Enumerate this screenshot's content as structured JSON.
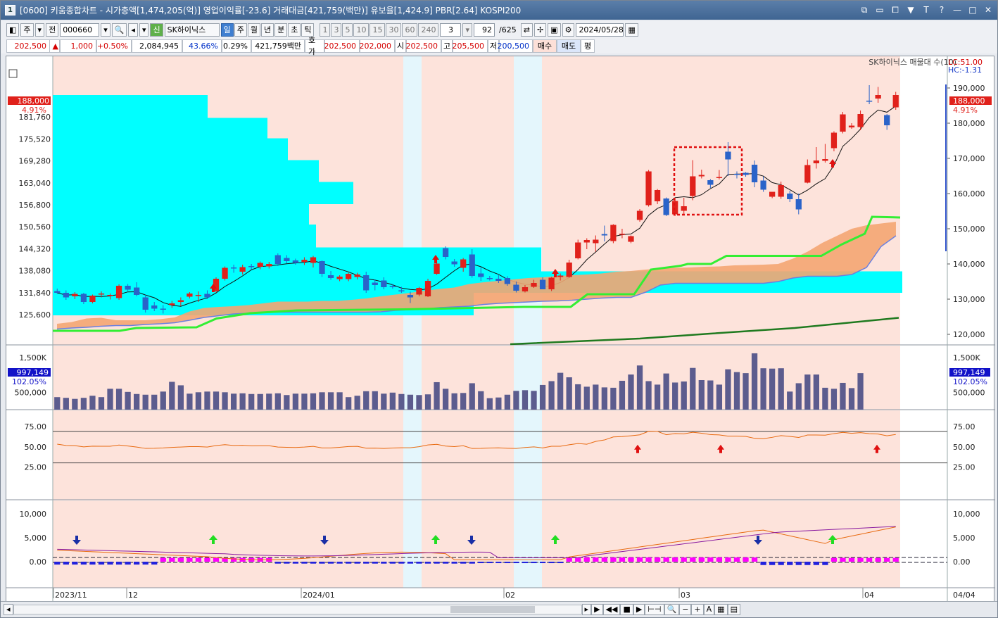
{
  "window": {
    "title": "[0600] 키움종합차트 - 시가총액[1,474,205(억)] 영업이익률[-23.6] 거래대금[421,759(백만)] 유보율[1,424.9] PBR[2.64] KOSPI200",
    "icon_label": "1",
    "controls": [
      "link-icon",
      "minimize-box-icon",
      "restore-box-icon",
      "pin-icon",
      "font-icon",
      "help-icon",
      "minimize-icon",
      "maximize-icon",
      "close-icon"
    ]
  },
  "toolbar": {
    "period_type": "주",
    "all_label": "전",
    "code": "000660",
    "badge": "신",
    "stock_name": "SK하이닉스",
    "periods": [
      "일",
      "주",
      "월",
      "년",
      "분",
      "초",
      "틱"
    ],
    "active_period": "일",
    "intervals": [
      "1",
      "3",
      "5",
      "10",
      "15",
      "30",
      "60",
      "240"
    ],
    "interval_value": "3",
    "count": "92",
    "total": "/625",
    "date": "2024/05/28"
  },
  "quote": {
    "price": "202,500",
    "change_sign": "▲",
    "change": "1,000",
    "change_pct": "+0.50%",
    "volume": "2,084,945",
    "vol_ratio": "43.66%",
    "turnover_pct": "0.29%",
    "amount": "421,759백만",
    "hoga_label": "호가",
    "hoga_ask": "202,500",
    "hoga_bid": "202,000",
    "open_label": "시",
    "open": "202,500",
    "high_label": "고",
    "high": "205,500",
    "low_label": "저",
    "low": "200,500",
    "buy_label": "매수",
    "sell_label": "매도",
    "flat_label": "평"
  },
  "colors": {
    "up": "#e0211b",
    "down": "#2a63c9",
    "background_shade": "#fde3db",
    "highlight_band": "#e4f6fc",
    "volume_profile": "#00ffff",
    "cloud": "#f4a572",
    "leading_span": "#33ee33",
    "long_ma": "#1f7a1f",
    "volume_bar": "#5c5c8e",
    "oscillator": "#ff00ff"
  },
  "legend": {
    "series_name": "SK하이닉스 매물대 수(10)",
    "lc": "LC:51.00",
    "hc": "HC:-1.31"
  },
  "price_panel": {
    "current_price_label": "188,000",
    "current_pct_label": "4.91%",
    "left_ticks": [
      "181,760",
      "175,520",
      "169,280",
      "163,040",
      "156,800",
      "150,560",
      "144,320",
      "138,080",
      "131,840",
      "125,600"
    ],
    "right_ticks": [
      "190,000",
      "180,000",
      "170,000",
      "160,000",
      "150,000",
      "140,000",
      "130,000",
      "120,000"
    ]
  },
  "volume_panel": {
    "ticks": [
      "1,500K",
      "500,000"
    ],
    "current_label": "997,149",
    "current_pct": "102.05%"
  },
  "rsi_panel": {
    "ticks": [
      "75.00",
      "50.00",
      "25.00"
    ]
  },
  "macd_panel": {
    "ticks": [
      "10,000",
      "5,000",
      "0.00"
    ]
  },
  "x_axis": {
    "labels": [
      "2023/11",
      "12",
      "2024/01",
      "02",
      "03",
      "04"
    ],
    "right_label": "04/04"
  },
  "chart_data": {
    "type": "candlestick",
    "y_range": [
      117000,
      193000
    ],
    "candles": [
      {
        "o": 132300,
        "h": 133000,
        "l": 131500,
        "c": 131800
      },
      {
        "o": 131800,
        "h": 132500,
        "l": 129800,
        "c": 130500
      },
      {
        "o": 130800,
        "h": 132000,
        "l": 130000,
        "c": 131500
      },
      {
        "o": 131500,
        "h": 131800,
        "l": 128600,
        "c": 129200
      },
      {
        "o": 129200,
        "h": 131300,
        "l": 128800,
        "c": 131000
      },
      {
        "o": 131300,
        "h": 132200,
        "l": 130500,
        "c": 131600
      },
      {
        "o": 130900,
        "h": 131600,
        "l": 129900,
        "c": 131200
      },
      {
        "o": 130300,
        "h": 134200,
        "l": 129800,
        "c": 133800
      },
      {
        "o": 133800,
        "h": 134300,
        "l": 132300,
        "c": 132700
      },
      {
        "o": 133300,
        "h": 134800,
        "l": 130800,
        "c": 131200
      },
      {
        "o": 130500,
        "h": 131200,
        "l": 126200,
        "c": 127000
      },
      {
        "o": 128200,
        "h": 129200,
        "l": 126600,
        "c": 127300
      },
      {
        "o": 127300,
        "h": 128300,
        "l": 125900,
        "c": 127000
      },
      {
        "o": 128300,
        "h": 129500,
        "l": 127500,
        "c": 128800
      },
      {
        "o": 129200,
        "h": 130500,
        "l": 128000,
        "c": 129700
      },
      {
        "o": 130700,
        "h": 132000,
        "l": 130200,
        "c": 131600
      },
      {
        "o": 131000,
        "h": 132200,
        "l": 129200,
        "c": 131200
      },
      {
        "o": 131500,
        "h": 132500,
        "l": 130000,
        "c": 130500
      },
      {
        "o": 132300,
        "h": 136200,
        "l": 131800,
        "c": 135800
      },
      {
        "o": 135800,
        "h": 139300,
        "l": 135300,
        "c": 138900
      },
      {
        "o": 139000,
        "h": 139800,
        "l": 137500,
        "c": 138700
      },
      {
        "o": 137800,
        "h": 139800,
        "l": 137000,
        "c": 139100
      },
      {
        "o": 139400,
        "h": 140000,
        "l": 138400,
        "c": 139200
      },
      {
        "o": 139200,
        "h": 140700,
        "l": 138500,
        "c": 140300
      },
      {
        "o": 139300,
        "h": 140600,
        "l": 138700,
        "c": 140000
      },
      {
        "o": 142500,
        "h": 143000,
        "l": 139400,
        "c": 140000
      },
      {
        "o": 141700,
        "h": 142500,
        "l": 140200,
        "c": 140800
      },
      {
        "o": 141000,
        "h": 141500,
        "l": 139800,
        "c": 140300
      },
      {
        "o": 140600,
        "h": 141900,
        "l": 139700,
        "c": 141200
      },
      {
        "o": 140300,
        "h": 142300,
        "l": 139000,
        "c": 141900
      },
      {
        "o": 140800,
        "h": 141000,
        "l": 136300,
        "c": 137200
      },
      {
        "o": 136800,
        "h": 138000,
        "l": 135500,
        "c": 136000
      },
      {
        "o": 135700,
        "h": 136800,
        "l": 135100,
        "c": 136400
      },
      {
        "o": 135700,
        "h": 137500,
        "l": 135100,
        "c": 137200
      },
      {
        "o": 136300,
        "h": 137500,
        "l": 135600,
        "c": 137000
      },
      {
        "o": 136800,
        "h": 137800,
        "l": 131800,
        "c": 132500
      },
      {
        "o": 134700,
        "h": 135600,
        "l": 132500,
        "c": 134000
      },
      {
        "o": 135300,
        "h": 136200,
        "l": 132800,
        "c": 133400
      },
      {
        "o": 133700,
        "h": 134300,
        "l": 133000,
        "c": 133500
      },
      {
        "o": 132500,
        "h": 133500,
        "l": 131800,
        "c": 132300
      },
      {
        "o": 131200,
        "h": 132100,
        "l": 128900,
        "c": 130500
      },
      {
        "o": 131300,
        "h": 133500,
        "l": 130800,
        "c": 133200
      },
      {
        "o": 130800,
        "h": 135800,
        "l": 130600,
        "c": 135200
      },
      {
        "o": 137200,
        "h": 140700,
        "l": 136900,
        "c": 140100
      },
      {
        "o": 144500,
        "h": 145000,
        "l": 141300,
        "c": 142000
      },
      {
        "o": 140700,
        "h": 141400,
        "l": 139200,
        "c": 139900
      },
      {
        "o": 138900,
        "h": 141700,
        "l": 137800,
        "c": 141300
      },
      {
        "o": 142700,
        "h": 144200,
        "l": 136100,
        "c": 136600
      },
      {
        "o": 137300,
        "h": 139000,
        "l": 135200,
        "c": 136300
      },
      {
        "o": 136000,
        "h": 136600,
        "l": 135300,
        "c": 135800
      },
      {
        "o": 135800,
        "h": 136800,
        "l": 134600,
        "c": 135200
      },
      {
        "o": 136000,
        "h": 136500,
        "l": 133800,
        "c": 134300
      },
      {
        "o": 134100,
        "h": 135000,
        "l": 131900,
        "c": 132400
      },
      {
        "o": 132200,
        "h": 134000,
        "l": 131900,
        "c": 133400
      },
      {
        "o": 133500,
        "h": 135500,
        "l": 133200,
        "c": 134600
      },
      {
        "o": 135500,
        "h": 136200,
        "l": 132800,
        "c": 132800
      },
      {
        "o": 132800,
        "h": 136300,
        "l": 132300,
        "c": 136100
      },
      {
        "o": 136300,
        "h": 137300,
        "l": 135300,
        "c": 136700
      },
      {
        "o": 136300,
        "h": 141200,
        "l": 136100,
        "c": 140400
      },
      {
        "o": 141600,
        "h": 146900,
        "l": 141300,
        "c": 146100
      },
      {
        "o": 146100,
        "h": 147300,
        "l": 144200,
        "c": 146800
      },
      {
        "o": 145900,
        "h": 148100,
        "l": 143500,
        "c": 146900
      },
      {
        "o": 148500,
        "h": 150900,
        "l": 146400,
        "c": 148100
      },
      {
        "o": 146500,
        "h": 151300,
        "l": 145900,
        "c": 151100
      },
      {
        "o": 148300,
        "h": 150000,
        "l": 147300,
        "c": 148600
      },
      {
        "o": 146300,
        "h": 148100,
        "l": 145900,
        "c": 147900
      },
      {
        "o": 152500,
        "h": 155600,
        "l": 152000,
        "c": 155100
      },
      {
        "o": 156700,
        "h": 166700,
        "l": 156300,
        "c": 166300
      },
      {
        "o": 157800,
        "h": 161300,
        "l": 157000,
        "c": 161000
      },
      {
        "o": 158600,
        "h": 158900,
        "l": 153600,
        "c": 153900
      },
      {
        "o": 154100,
        "h": 158800,
        "l": 153600,
        "c": 157900
      },
      {
        "o": 155100,
        "h": 158800,
        "l": 154200,
        "c": 156400
      },
      {
        "o": 159300,
        "h": 169500,
        "l": 158100,
        "c": 164900
      },
      {
        "o": 164900,
        "h": 166800,
        "l": 164300,
        "c": 165300
      },
      {
        "o": 163800,
        "h": 164100,
        "l": 161600,
        "c": 162500
      },
      {
        "o": 164400,
        "h": 166700,
        "l": 164000,
        "c": 164700
      },
      {
        "o": 171900,
        "h": 174600,
        "l": 165000,
        "c": 169700
      },
      {
        "o": 165600,
        "h": 166300,
        "l": 164300,
        "c": 165500
      },
      {
        "o": 165900,
        "h": 166100,
        "l": 164800,
        "c": 165300
      },
      {
        "o": 168200,
        "h": 169400,
        "l": 161800,
        "c": 163200
      },
      {
        "o": 163700,
        "h": 164900,
        "l": 160500,
        "c": 161100
      },
      {
        "o": 159100,
        "h": 159900,
        "l": 158700,
        "c": 160500
      },
      {
        "o": 159100,
        "h": 163400,
        "l": 158500,
        "c": 162400
      },
      {
        "o": 160000,
        "h": 160800,
        "l": 157600,
        "c": 158400
      },
      {
        "o": 158400,
        "h": 160000,
        "l": 154100,
        "c": 155500
      },
      {
        "o": 163100,
        "h": 169700,
        "l": 162900,
        "c": 168100
      },
      {
        "o": 168600,
        "h": 173200,
        "l": 167100,
        "c": 169400
      },
      {
        "o": 169300,
        "h": 174100,
        "l": 168800,
        "c": 169800
      },
      {
        "o": 172900,
        "h": 177700,
        "l": 172000,
        "c": 177300
      },
      {
        "o": 177600,
        "h": 183200,
        "l": 177100,
        "c": 182500
      },
      {
        "o": 178800,
        "h": 180000,
        "l": 178400,
        "c": 179300
      },
      {
        "o": 178900,
        "h": 183600,
        "l": 178000,
        "c": 182600
      },
      {
        "o": 186400,
        "h": 190800,
        "l": 185400,
        "c": 186300
      },
      {
        "o": 187000,
        "h": 190300,
        "l": 185800,
        "c": 188000
      },
      {
        "o": 182300,
        "h": 182600,
        "l": 178100,
        "c": 179400
      },
      {
        "o": 184500,
        "h": 188900,
        "l": 183800,
        "c": 188000
      }
    ],
    "volume": [
      360,
      340,
      310,
      340,
      400,
      360,
      600,
      600,
      510,
      450,
      430,
      430,
      520,
      800,
      700,
      460,
      500,
      520,
      520,
      500,
      460,
      470,
      450,
      450,
      460,
      470,
      420,
      460,
      460,
      470,
      500,
      500,
      500,
      360,
      400,
      530,
      530,
      460,
      490,
      450,
      430,
      420,
      440,
      790,
      600,
      470,
      480,
      760,
      530,
      330,
      350,
      430,
      540,
      560,
      540,
      710,
      820,
      1060,
      930,
      730,
      660,
      720,
      640,
      630,
      830,
      1010,
      1270,
      820,
      720,
      1040,
      780,
      810,
      1200,
      850,
      840,
      720,
      1160,
      1080,
      1050,
      1620,
      1190,
      1180,
      1190,
      520,
      760,
      1010,
      1010,
      630,
      600,
      770,
      620,
      1050
    ]
  }
}
